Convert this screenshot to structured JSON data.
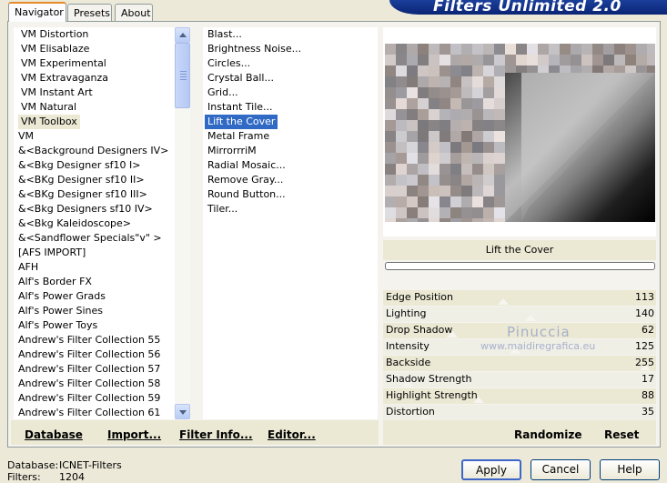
{
  "tabs": [
    {
      "label": "Navigator",
      "active": true
    },
    {
      "label": "Presets",
      "active": false
    },
    {
      "label": "About",
      "active": false
    }
  ],
  "banner_title": "Filters Unlimited 2.0",
  "categories": [
    "VM Distortion",
    "VM Elisablaze",
    "VM Experimental",
    "VM Extravaganza",
    "VM Instant Art",
    "VM Natural",
    "VM Toolbox",
    "VM",
    "&<Background Designers IV>",
    "&<Bkg Designer sf10 I>",
    "&<BKg Designer sf10 II>",
    "&<BKg Designer sf10 III>",
    "&<Bkg Designers sf10 IV>",
    "&<Bkg Kaleidoscope>",
    "&<Sandflower Specials\"v\" >",
    "[AFS IMPORT]",
    "AFH",
    "Alf's Border FX",
    "Alf's Power Grads",
    "Alf's Power Sines",
    "Alf's Power Toys",
    "Andrew's Filter Collection 55",
    "Andrew's Filter Collection 56",
    "Andrew's Filter Collection 57",
    "Andrew's Filter Collection 58",
    "Andrew's Filter Collection 59",
    "Andrew's Filter Collection 61"
  ],
  "selected_category": "VM Toolbox",
  "filters": [
    "Blast...",
    "Brightness Noise...",
    "Circles...",
    "Crystal Ball...",
    "Grid...",
    "Instant Tile...",
    "Lift the Cover",
    "Metal Frame",
    "MirrorrriM",
    "Radial Mosaic...",
    "Remove Gray...",
    "Round Button...",
    "Tiler..."
  ],
  "selected_filter": "Lift the Cover",
  "filter_title": "Lift the Cover",
  "watermark": {
    "line1": "Pinuccia",
    "line2": "www.maidiregrafica.eu"
  },
  "params": [
    {
      "name": "Edge Position",
      "value": "113",
      "level": 0.443
    },
    {
      "name": "Lighting",
      "value": "140",
      "level": 0.549
    },
    {
      "name": "Drop Shadow",
      "value": "62",
      "level": 0.243
    },
    {
      "name": "Intensity",
      "value": "125",
      "level": 0.49
    },
    {
      "name": "Backside",
      "value": "255",
      "level": 1.0
    },
    {
      "name": "Shadow Strength",
      "value": "17",
      "level": 0.067
    },
    {
      "name": "Highlight Strength",
      "value": "88",
      "level": 0.345
    },
    {
      "name": "Distortion",
      "value": "35",
      "level": 0.137
    }
  ],
  "toolbar": {
    "database": "Database",
    "import": "Import...",
    "filter_info": "Filter Info...",
    "editor": "Editor...",
    "randomize": "Randomize",
    "reset": "Reset"
  },
  "status": {
    "database_label": "Database:",
    "database_value": "ICNET-Filters",
    "filters_label": "Filters:",
    "filters_value": "1204"
  },
  "dialog_buttons": {
    "apply": "Apply",
    "cancel": "Cancel",
    "help": "Help"
  },
  "colors": {
    "selection": "#316ac5",
    "banner": "#0b2475",
    "tab_highlight": "#e68b2c"
  }
}
